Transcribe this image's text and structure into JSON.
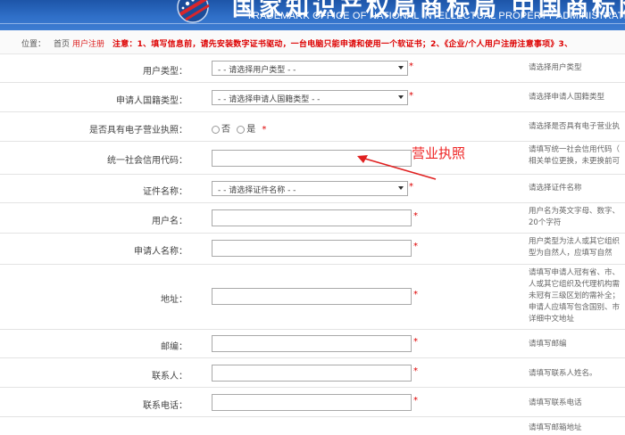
{
  "header": {
    "title_cn": "国家知识产权局商标局 中国商标网",
    "title_en": "TRADEMARK OFFICE OF NATIONAL INTELLECTUAL PROPERTY ADMINISTRATION,PRC"
  },
  "notice": {
    "location_label": "位置：",
    "home": "首页",
    "current": "用户注册",
    "text": "注意：1、填写信息前，请先安装数字证书驱动，一台电脑只能申请和使用一个软证书；2、《企业/个人用户注册注意事项》3、"
  },
  "form": {
    "user_type": {
      "label": "用户类型：",
      "value": "- - 请选择用户类型 - -",
      "required": "*",
      "hint": "请选择用户类型"
    },
    "nationality": {
      "label": "申请人国籍类型：",
      "value": "- - 请选择申请人国籍类型 - -",
      "required": "*",
      "hint": "请选择申请人国籍类型"
    },
    "e_license": {
      "label": "是否具有电子营业执照：",
      "option_no": "否",
      "option_yes": "是",
      "required": "*",
      "hint": "请选择是否具有电子营业执"
    },
    "credit_code": {
      "label": "统一社会信用代码：",
      "value": "",
      "hint_lines": [
        "请填写统一社会信用代码（",
        "相关单位更换，未更换前可"
      ]
    },
    "id_type": {
      "label": "证件名称：",
      "value": "- - 请选择证件名称 - -",
      "required": "*",
      "hint": "请选择证件名称"
    },
    "username": {
      "label": "用户名：",
      "value": "",
      "required": "*",
      "hint_lines": [
        "用户名为英文字母、数字、",
        "20个字符"
      ]
    },
    "applicant_name": {
      "label": "申请人名称：",
      "value": "",
      "required": "*",
      "hint_lines": [
        "用户类型为法人或其它组织",
        "型为自然人，应填写自然"
      ]
    },
    "address": {
      "label": "地址：",
      "value": "",
      "required": "*",
      "hint_lines": [
        "请填写申请人冠有省、市、",
        "人或其它组织及代理机构需",
        "未冠有三级区划的需补全；",
        "申请人应填写包含国别、市",
        "详细中文地址"
      ]
    },
    "postcode": {
      "label": "邮编：",
      "value": "",
      "required": "*",
      "hint": "请填写邮编"
    },
    "contact": {
      "label": "联系人：",
      "value": "",
      "required": "*",
      "hint": "请填写联系人姓名。"
    },
    "phone": {
      "label": "联系电话：",
      "value": "",
      "required": "*",
      "hint": "请填写联系电话"
    },
    "last_row_hint": "请填写邮箱地址"
  },
  "annotation": {
    "text": "营业执照",
    "color": "#e02020"
  },
  "colors": {
    "banner": "#2f6fc8",
    "required": "#dd0000",
    "notice": "#dd0000"
  }
}
